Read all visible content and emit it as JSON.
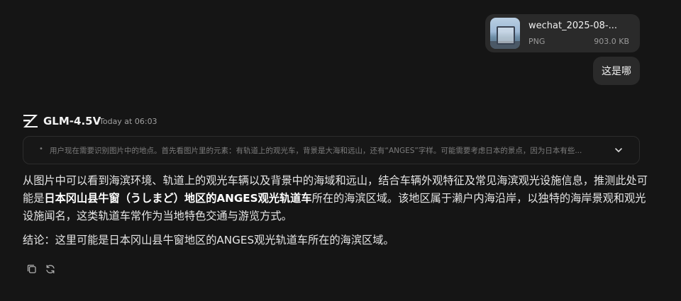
{
  "attachment": {
    "file_name": "wechat_2025-08-...",
    "file_type": "PNG",
    "file_size": "903.0 KB"
  },
  "user_message": "这是哪",
  "assistant": {
    "model_name": "GLM-4.5V",
    "timestamp": "Today at 06:03",
    "thinking_summary": "用户现在需要识别图片中的地点。首先看图片里的元素：有轨道上的观光车，背景是大海和远山，还有“ANGES”字样。可能需要考虑日本的景点，因为日本有些...",
    "answer_part1": "从图片中可以看到海滨环境、轨道上的观光车辆以及背景中的海域和远山，结合车辆外观特征及常见海滨观光设施信息，推测此处可能是",
    "answer_bold": "日本冈山县牛窗（うしまど）地区的ANGES观光轨道车",
    "answer_part2": "所在的海滨区域。该地区属于濑户内海沿岸，以独特的海岸景观和观光设施闻名，这类轨道车常作为当地特色交通与游览方式。",
    "conclusion": "结论：这里可能是日本冈山县牛窗地区的ANGES观光轨道车所在的海滨区域。"
  },
  "icons": {
    "logo": "z-logo-icon",
    "expand": "chevron-down-icon",
    "copy": "copy-icon",
    "regenerate": "refresh-icon"
  },
  "colors": {
    "background": "#151515",
    "bubble": "#2a2a2a",
    "text": "#e6e6e6",
    "muted": "#7c7c7c"
  }
}
